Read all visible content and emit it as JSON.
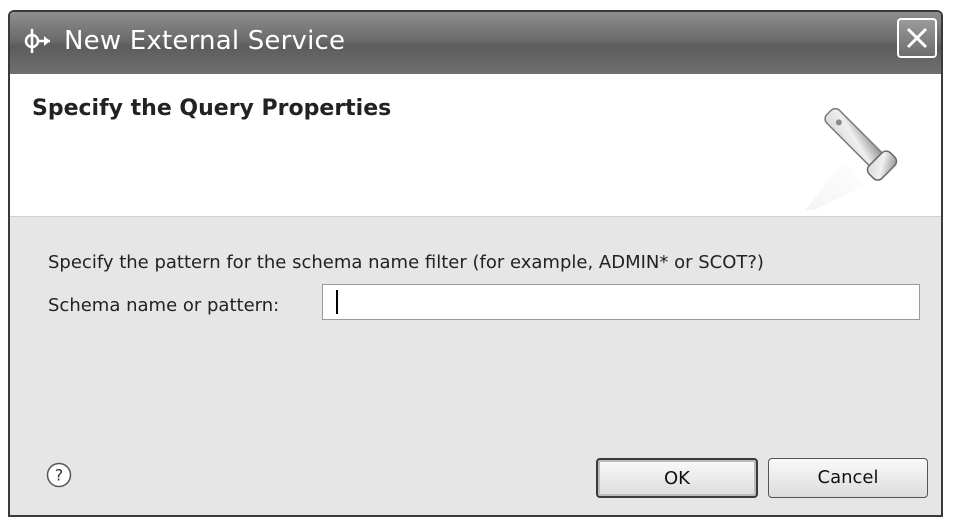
{
  "window": {
    "title": "New External Service",
    "icons": {
      "app": "service-wizard-icon",
      "close": "close-icon"
    }
  },
  "header": {
    "title": "Specify the Query Properties",
    "icon": "flashlight-icon"
  },
  "body": {
    "description": "Specify the pattern for the schema name filter (for example, ADMIN* or SCOT?)",
    "schema_label": "Schema name or pattern:",
    "schema_value": "",
    "schema_placeholder": ""
  },
  "footer": {
    "help_icon": "help-icon",
    "ok_label": "OK",
    "cancel_label": "Cancel"
  }
}
